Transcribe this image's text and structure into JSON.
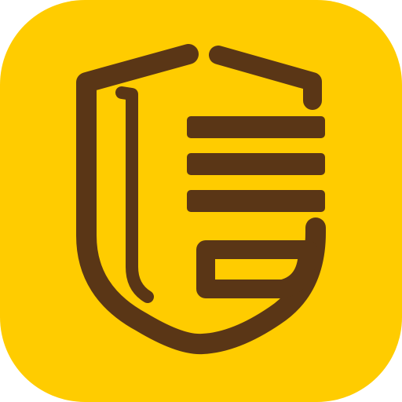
{
  "icon": {
    "name": "shield-logo-icon",
    "background_color": "#FFCC00",
    "glyph_color": "#5A3616",
    "outer_background": "#FFFFFF"
  }
}
